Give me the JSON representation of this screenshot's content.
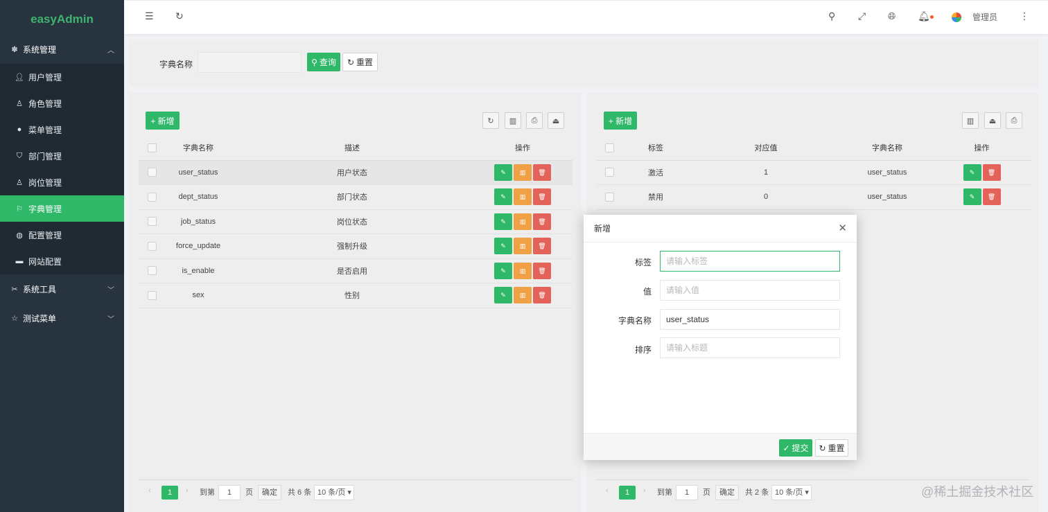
{
  "app": {
    "logo": "easyAdmin"
  },
  "sidebar": {
    "groups": [
      {
        "label": "系统管理",
        "icon": "gear-icon",
        "expanded": true
      },
      {
        "label": "系统工具",
        "icon": "tools-icon",
        "expanded": false
      },
      {
        "label": "测试菜单",
        "icon": "star-icon",
        "expanded": false
      }
    ],
    "items": [
      {
        "label": "用户管理",
        "icon": "user-icon"
      },
      {
        "label": "角色管理",
        "icon": "role-icon"
      },
      {
        "label": "菜单管理",
        "icon": "menu-icon"
      },
      {
        "label": "部门管理",
        "icon": "shield-icon"
      },
      {
        "label": "岗位管理",
        "icon": "post-icon"
      },
      {
        "label": "字典管理",
        "icon": "flag-icon",
        "active": true
      },
      {
        "label": "配置管理",
        "icon": "config-icon"
      },
      {
        "label": "网站配置",
        "icon": "site-icon"
      }
    ]
  },
  "header": {
    "user": "管理员",
    "accent": "#2fb868"
  },
  "search": {
    "label": "字典名称",
    "value": "",
    "query_label": "查询",
    "reset_label": "重置"
  },
  "left": {
    "add_label": "+ 新增",
    "headers": [
      "字典名称",
      "描述",
      "操作"
    ],
    "rows": [
      {
        "name": "user_status",
        "desc": "用户状态"
      },
      {
        "name": "dept_status",
        "desc": "部门状态"
      },
      {
        "name": "job_status",
        "desc": "岗位状态"
      },
      {
        "name": "force_update",
        "desc": "强制升级"
      },
      {
        "name": "is_enable",
        "desc": "是否启用"
      },
      {
        "name": "sex",
        "desc": "性别"
      }
    ],
    "pager": {
      "current": "1",
      "goto": "到第",
      "page_input": "1",
      "page": "页",
      "confirm": "确定",
      "total": "共 6 条",
      "size": "10 条/页"
    }
  },
  "right": {
    "add_label": "+ 新增",
    "headers": [
      "标签",
      "对应值",
      "字典名称",
      "操作"
    ],
    "rows": [
      {
        "label": "激活",
        "value": "1",
        "dict": "user_status"
      },
      {
        "label": "禁用",
        "value": "0",
        "dict": "user_status"
      }
    ],
    "pager": {
      "current": "1",
      "goto": "到第",
      "page_input": "1",
      "page": "页",
      "confirm": "确定",
      "total": "共 2 条",
      "size": "10 条/页"
    }
  },
  "modal": {
    "title": "新增",
    "fields": [
      {
        "label": "标签",
        "placeholder": "请输入标签",
        "value": ""
      },
      {
        "label": "值",
        "placeholder": "请输入值",
        "value": ""
      },
      {
        "label": "字典名称",
        "placeholder": "",
        "value": "user_status"
      },
      {
        "label": "排序",
        "placeholder": "请输入标题",
        "value": ""
      }
    ],
    "submit_label": "提交",
    "reset_label": "重置"
  },
  "watermark": "@稀土掘金技术社区"
}
